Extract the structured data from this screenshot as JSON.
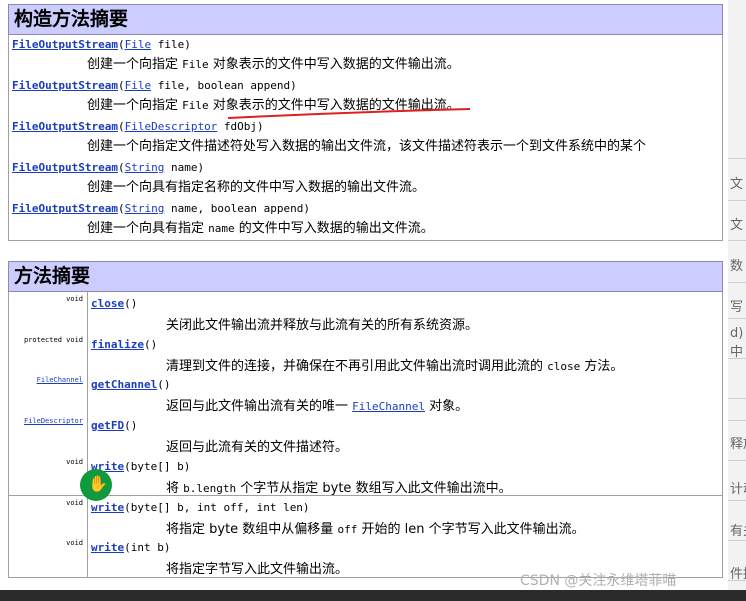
{
  "constructor_summary": {
    "title": "构造方法摘要",
    "rows": [
      {
        "name": "FileOutputStream",
        "open": "(",
        "ptype": "File",
        "params": " file)",
        "desc_pre": "创建一个向指定 ",
        "desc_code": "File",
        "desc_post": " 对象表示的文件中写入数据的文件输出流。"
      },
      {
        "name": "FileOutputStream",
        "open": "(",
        "ptype": "File",
        "params": " file, boolean append)",
        "desc_pre": "创建一个向指定 ",
        "desc_code": "File",
        "desc_post": " 对象表示的文件中写入数据的文件输出流。"
      },
      {
        "name": "FileOutputStream",
        "open": "(",
        "ptype": "FileDescriptor",
        "params": " fdObj)",
        "desc_pre": "创建一个向指定文件描述符处写入数据的输出文件流，该文件描述符表示一个到文件系统中的某个",
        "desc_code": "",
        "desc_post": ""
      },
      {
        "name": "FileOutputStream",
        "open": "(",
        "ptype": "String",
        "params": " name)",
        "desc_pre": "创建一个向具有指定名称的文件中写入数据的输出文件流。",
        "desc_code": "",
        "desc_post": ""
      },
      {
        "name": "FileOutputStream",
        "open": "(",
        "ptype": "String",
        "params": " name, boolean append)",
        "desc_pre": "创建一个向具有指定 ",
        "desc_code": "name",
        "desc_post": " 的文件中写入数据的输出文件流。"
      }
    ]
  },
  "method_summary": {
    "title": "方法摘要",
    "rows": [
      {
        "modifier": "",
        "type": "void",
        "type_link": "",
        "name": "close",
        "params": "()",
        "desc_pre": "关闭此文件输出流并释放与此流有关的所有系统资源。",
        "desc_code": "",
        "desc_link": "",
        "desc_post": ""
      },
      {
        "modifier": "protected ",
        "type": "void",
        "type_link": "",
        "name": "finalize",
        "params": "()",
        "desc_pre": "清理到文件的连接，并确保在不再引用此文件输出流时调用此流的 ",
        "desc_code": "close",
        "desc_link": "",
        "desc_post": " 方法。"
      },
      {
        "modifier": "",
        "type": "",
        "type_link": "FileChannel",
        "name": "getChannel",
        "params": "()",
        "desc_pre": "返回与此文件输出流有关的唯一 ",
        "desc_code": "",
        "desc_link": "FileChannel",
        "desc_post": " 对象。"
      },
      {
        "modifier": "",
        "type": "",
        "type_link": "FileDescriptor",
        "name": "getFD",
        "params": "()",
        "desc_pre": "返回与此流有关的文件描述符。",
        "desc_code": "",
        "desc_link": "",
        "desc_post": ""
      },
      {
        "modifier": "",
        "type": "void",
        "type_link": "",
        "name": "write",
        "params": "(byte[] b)",
        "desc_pre": "将 ",
        "desc_code": "b.length",
        "desc_link": "",
        "desc_post": " 个字节从指定 byte 数组写入此文件输出流中。"
      },
      {
        "modifier": "",
        "type": "void",
        "type_link": "",
        "name": "write",
        "params": "(byte[] b, int off, int len)",
        "desc_pre": "将指定 byte 数组中从偏移量 ",
        "desc_code": "off",
        "desc_link": "",
        "desc_post": " 开始的 len 个字节写入此文件输出流。"
      },
      {
        "modifier": "",
        "type": "void",
        "type_link": "",
        "name": "write",
        "params": "(int b)",
        "desc_pre": "将指定字节写入此文件输出流。",
        "desc_code": "",
        "desc_link": "",
        "desc_post": ""
      }
    ]
  },
  "background_fragments": [
    "文",
    "文",
    "数",
    "写",
    "d)",
    "中",
    "释放",
    "计动",
    "有关",
    "件描"
  ],
  "watermark": "CSDN @关注永维塔菲喵",
  "colors": {
    "header_bg": "#ccccff",
    "link": "#1a3cc2",
    "annotation_red": "#e02020",
    "cursor_green": "#0f9a3c"
  },
  "cursor_icon": "hand-cursor-icon"
}
